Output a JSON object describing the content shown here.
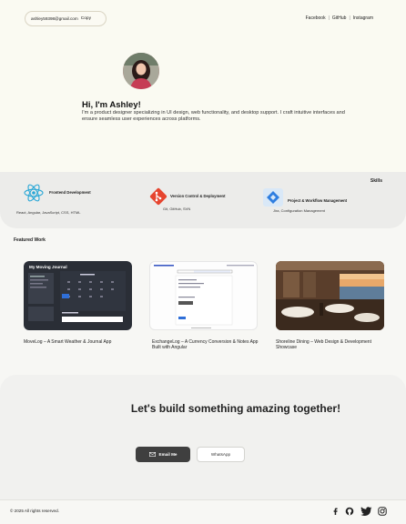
{
  "header": {
    "email": "ashley59398@gmail.com",
    "copy_label": "Copy",
    "links": [
      "Facebook",
      "GitHub",
      "Instagram"
    ],
    "separator": "|"
  },
  "hero": {
    "title": "Hi, I'm Ashley!",
    "description": "I'm a product designer specializing in UI design, web functionality, and desktop support. I craft intuitive interfaces and ensure seamless user experiences across platforms."
  },
  "skills": {
    "label": "Skills",
    "items": [
      {
        "title": "Frontend Development",
        "subtitle": "React, Angular, JavaScript, CSS, HTML",
        "icon": "react-icon"
      },
      {
        "title": "Version Control & Deployment",
        "subtitle": "Git, GitHub, SVN",
        "icon": "git-icon"
      },
      {
        "title": "Project & Workflow Management",
        "subtitle": "Jira, Configuration Management",
        "icon": "jira-icon"
      }
    ]
  },
  "featured": {
    "label": "Featured Work",
    "projects": [
      {
        "caption": "MoveLog – A Smart Weather & Journal App",
        "screen_title": "My Moving Journal"
      },
      {
        "caption": "ExchangeLog – A Currency Conversion & Notes App Built with Angular"
      },
      {
        "caption": "Shoreline Dining – Web Design & Development Showcase"
      }
    ]
  },
  "cta": {
    "title": "Let's build something amazing together!",
    "email_button": "Email Me",
    "whatsapp_button": "WhatsApp"
  },
  "footer": {
    "copyright": "© 2025 All rights reserved.",
    "social_icons": [
      "facebook-icon",
      "github-icon",
      "twitter-icon",
      "instagram-icon"
    ]
  }
}
